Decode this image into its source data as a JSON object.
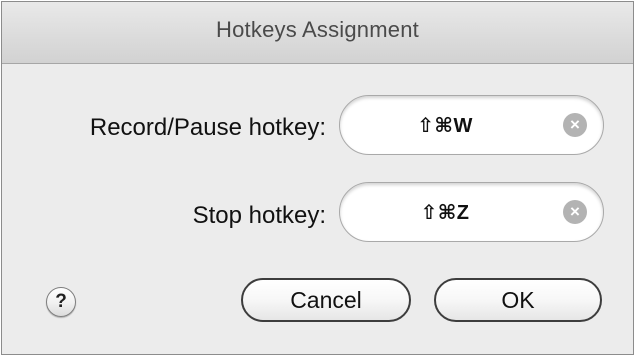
{
  "window": {
    "title": "Hotkeys Assignment"
  },
  "hotkeys": [
    {
      "label": "Record/Pause hotkey:",
      "value": "⇧⌘W",
      "clear_icon": "clear-x-icon"
    },
    {
      "label": "Stop hotkey:",
      "value": "⇧⌘Z",
      "clear_icon": "clear-x-icon"
    }
  ],
  "footer": {
    "help_label": "?",
    "cancel_label": "Cancel",
    "ok_label": "OK"
  }
}
